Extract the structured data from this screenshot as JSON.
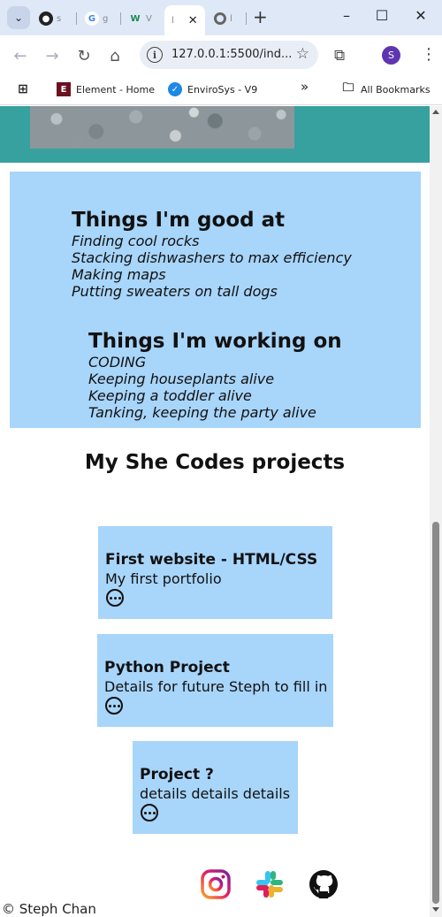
{
  "browser": {
    "tabs": [
      {
        "label": "s",
        "icon": "github-icon"
      },
      {
        "label": "g",
        "icon": "google-icon"
      },
      {
        "label": "V",
        "icon": "w-icon"
      },
      {
        "label": "l",
        "icon": "active-page-icon",
        "active": true
      },
      {
        "label": "l",
        "icon": "chrome-icon"
      }
    ],
    "url": "127.0.0.1:5500/ind...",
    "profile_initial": "S",
    "bookmarks": [
      {
        "label": "Element - Home",
        "icon": "element-icon"
      },
      {
        "label": "EnviroSys - V9",
        "icon": "envirosys-icon"
      }
    ],
    "more_bookmarks": "»",
    "all_bookmarks": "All Bookmarks"
  },
  "skills": {
    "good_title": "Things I'm good at",
    "good_items": [
      "Finding cool rocks",
      "Stacking dishwashers to max efficiency",
      "Making maps",
      "Putting sweaters on tall dogs"
    ],
    "work_title": "Things I'm working on",
    "work_items": [
      "CODING",
      "Keeping houseplants alive",
      "Keeping a toddler alive",
      "Tanking, keeping the party alive"
    ]
  },
  "projects": {
    "title": "My She Codes projects",
    "items": [
      {
        "title": "First website - HTML/CSS",
        "description": "My first portfolio"
      },
      {
        "title": "Python Project",
        "description": "Details for future Steph to fill in"
      },
      {
        "title": "Project ?",
        "description": "details details details"
      }
    ]
  },
  "footer": {
    "social": [
      "instagram-icon",
      "slack-icon",
      "github-icon"
    ],
    "copyright": "© Steph Chan"
  },
  "colors": {
    "card_bg": "#a8d5fa",
    "hero_teal": "#36a19f"
  }
}
